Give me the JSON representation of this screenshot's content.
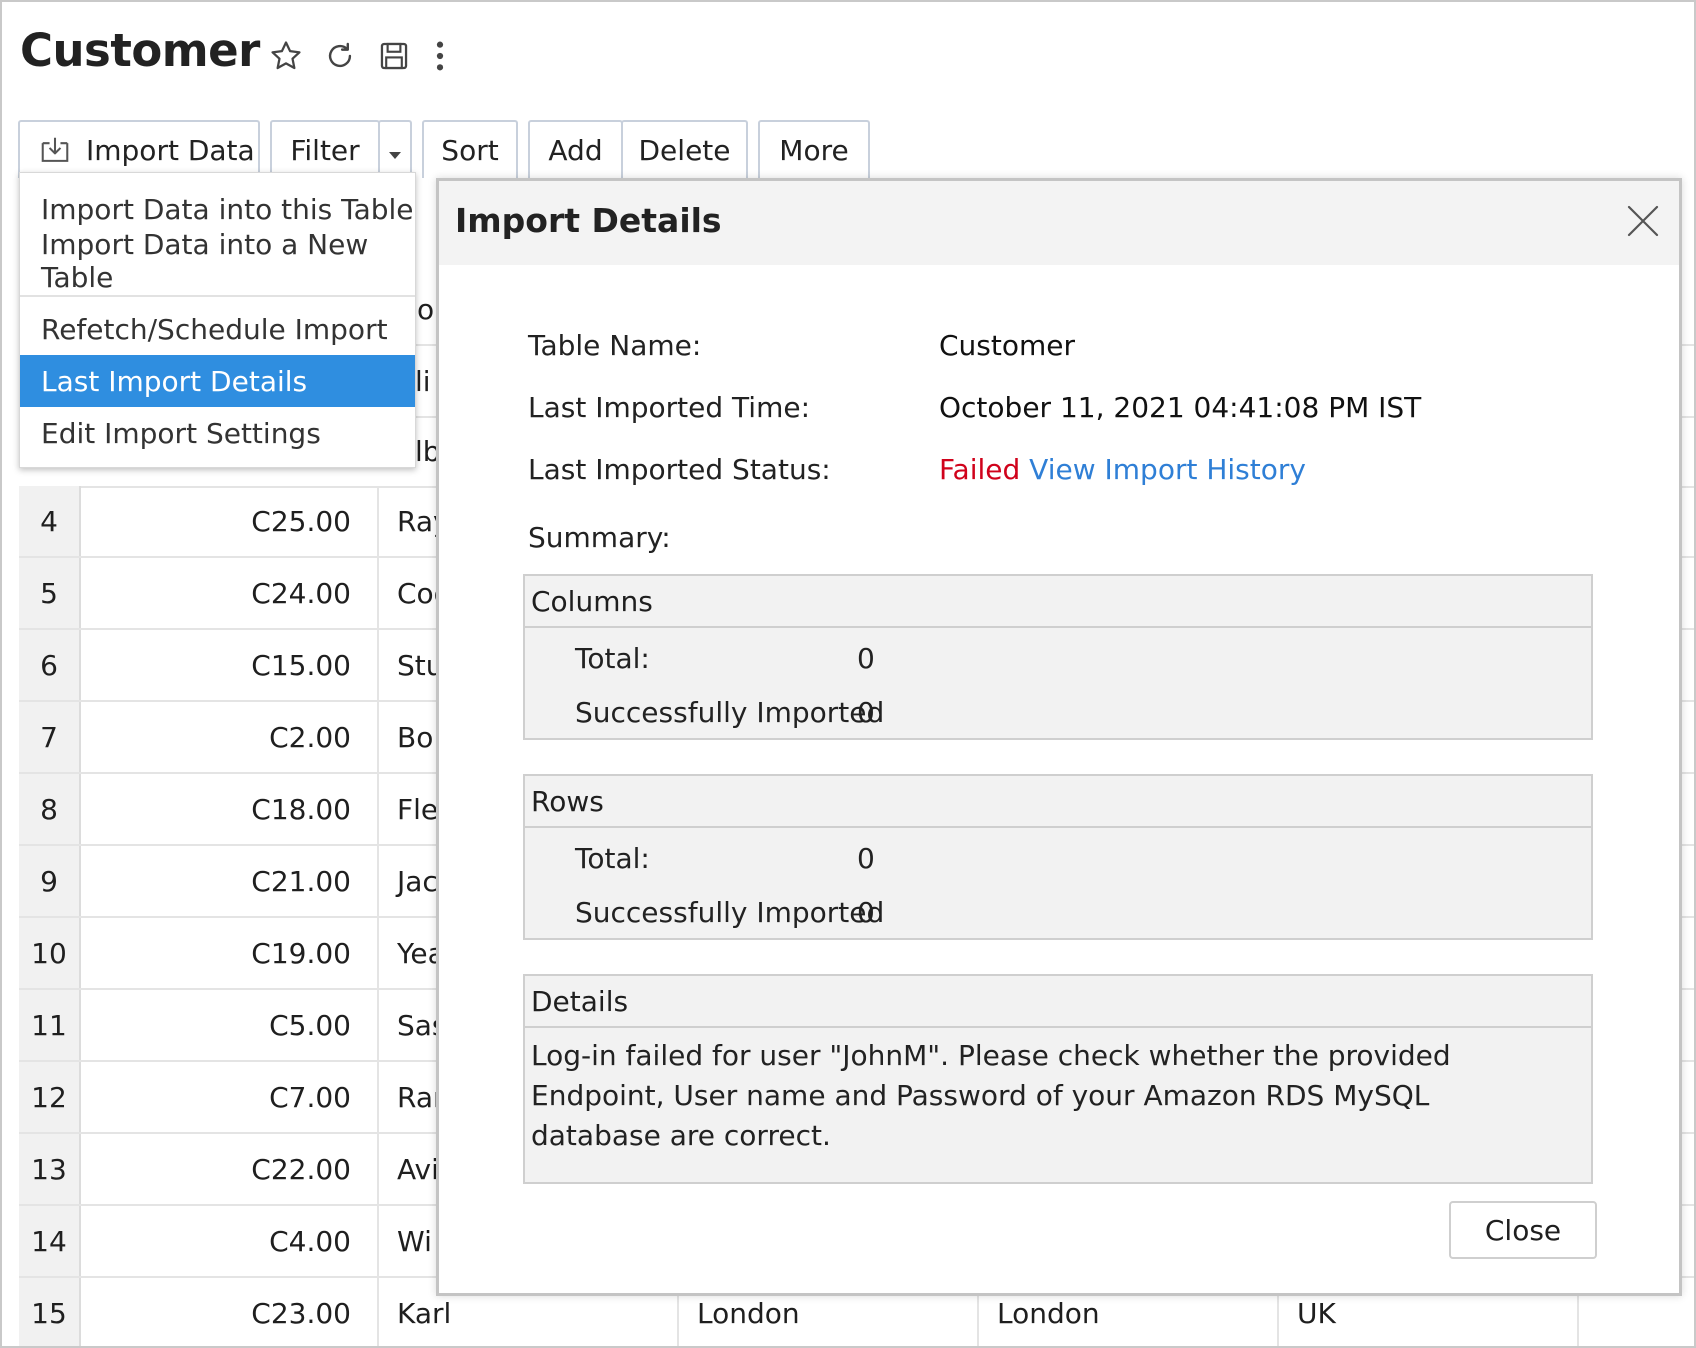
{
  "page": {
    "title": "Customer"
  },
  "header_icons": [
    "star-icon",
    "refresh-icon",
    "save-icon",
    "more-vertical-icon"
  ],
  "toolbar": {
    "import_label": "Import Data",
    "filter_label": "Filter",
    "sort_label": "Sort",
    "add_label": "Add",
    "delete_label": "Delete",
    "more_label": "More"
  },
  "import_menu": {
    "items": [
      {
        "label": "Import Data into this Table"
      },
      {
        "label": "Import Data into a New Table"
      },
      {
        "label": "Refetch/Schedule Import"
      },
      {
        "label": "Last Import Details",
        "active": true
      },
      {
        "label": "Edit Import Settings"
      }
    ]
  },
  "table": {
    "partial_top": [
      "o",
      "li",
      "lb"
    ],
    "rows": [
      {
        "num": "4",
        "code": "C25.00",
        "name": "Ray"
      },
      {
        "num": "5",
        "code": "C24.00",
        "name": "Coo"
      },
      {
        "num": "6",
        "code": "C15.00",
        "name": "Stu"
      },
      {
        "num": "7",
        "code": "C2.00",
        "name": "Bol"
      },
      {
        "num": "8",
        "code": "C18.00",
        "name": "Fle"
      },
      {
        "num": "9",
        "code": "C21.00",
        "name": "Jac"
      },
      {
        "num": "10",
        "code": "C19.00",
        "name": "Yea"
      },
      {
        "num": "11",
        "code": "C5.00",
        "name": "Sas"
      },
      {
        "num": "12",
        "code": "C7.00",
        "name": "Ran"
      },
      {
        "num": "13",
        "code": "C22.00",
        "name": "Avi"
      },
      {
        "num": "14",
        "code": "C4.00",
        "name": "Wi"
      },
      {
        "num": "15",
        "code": "C23.00",
        "name": "Karl",
        "col3": "London",
        "col4": "London",
        "col5": "UK"
      }
    ]
  },
  "dialog": {
    "title": "Import Details",
    "table_name_label": "Table Name:",
    "table_name_value": "Customer",
    "time_label": "Last Imported Time:",
    "time_value": "October 11, 2021 04:41:08 PM IST",
    "status_label": "Last Imported Status:",
    "status_value": "Failed",
    "history_link": "View Import History",
    "summary_label": "Summary:",
    "columns": {
      "title": "Columns",
      "total_label": "Total:",
      "total_value": "0",
      "success_label": "Successfully Imported",
      "success_value": "0"
    },
    "rows": {
      "title": "Rows",
      "total_label": "Total:",
      "total_value": "0",
      "success_label": "Successfully Imported",
      "success_value": "0"
    },
    "details": {
      "title": "Details",
      "message": "Log-in failed for user \"JohnM\". Please check whether the provided Endpoint, User name and Password of your Amazon RDS MySQL database are correct."
    },
    "close_label": "Close"
  }
}
